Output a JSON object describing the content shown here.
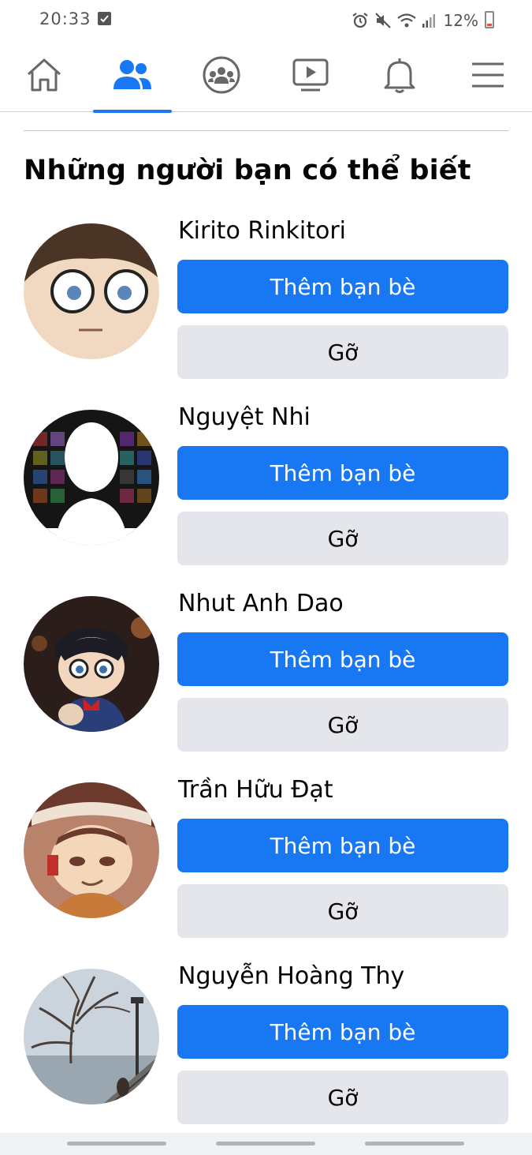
{
  "status_bar": {
    "time": "20:33",
    "battery": "12%",
    "icons": [
      "notification-check-icon",
      "alarm-icon",
      "mute-icon",
      "wifi-icon",
      "signal-icon",
      "battery-icon"
    ]
  },
  "nav": {
    "items": [
      {
        "icon": "home-icon",
        "active": false
      },
      {
        "icon": "friends-icon",
        "active": true
      },
      {
        "icon": "groups-icon",
        "active": false
      },
      {
        "icon": "watch-icon",
        "active": false
      },
      {
        "icon": "bell-icon",
        "active": false
      },
      {
        "icon": "menu-icon",
        "active": false
      }
    ],
    "accent": "#1877f2"
  },
  "section": {
    "title": "Những người bạn có thể biết"
  },
  "suggestions": [
    {
      "name": "Kirito Rinkitori",
      "add_label": "Thêm bạn bè",
      "remove_label": "Gỡ"
    },
    {
      "name": "Nguyệt Nhi",
      "add_label": "Thêm bạn bè",
      "remove_label": "Gỡ"
    },
    {
      "name": "Nhut Anh Dao",
      "add_label": "Thêm bạn bè",
      "remove_label": "Gỡ"
    },
    {
      "name": "Trần Hữu Đạt",
      "add_label": "Thêm bạn bè",
      "remove_label": "Gỡ"
    },
    {
      "name": "Nguyễn Hoàng Thy",
      "add_label": "Thêm bạn bè",
      "remove_label": "Gỡ"
    }
  ],
  "colors": {
    "primary_button": "#1877f2",
    "secondary_button": "#e4e6eb"
  }
}
